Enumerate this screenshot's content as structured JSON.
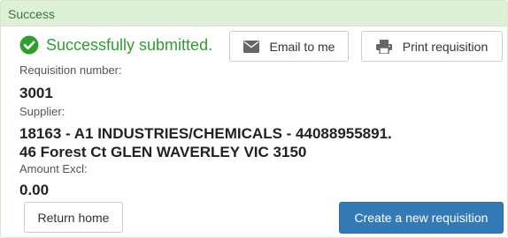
{
  "panel": {
    "heading": "Success"
  },
  "status": {
    "message": "Successfully submitted.",
    "icon": "check-circle-icon",
    "color": "#2e9e2e"
  },
  "actions": {
    "email_label": "Email to me",
    "print_label": "Print requisition",
    "return_label": "Return home",
    "create_label": "Create a new requisition"
  },
  "fields": {
    "requisition_number_label": "Requisition number:",
    "requisition_number": "3001",
    "supplier_label": "Supplier:",
    "supplier_line1": "18163 - A1 INDUSTRIES/CHEMICALS - 44088955891.",
    "supplier_line2": "46 Forest Ct GLEN WAVERLEY VIC 3150",
    "amount_label": "Amount Excl:",
    "amount": "0.00"
  },
  "colors": {
    "heading_bg": "#dff0d8",
    "heading_text": "#3c763d",
    "primary": "#337ab7"
  }
}
